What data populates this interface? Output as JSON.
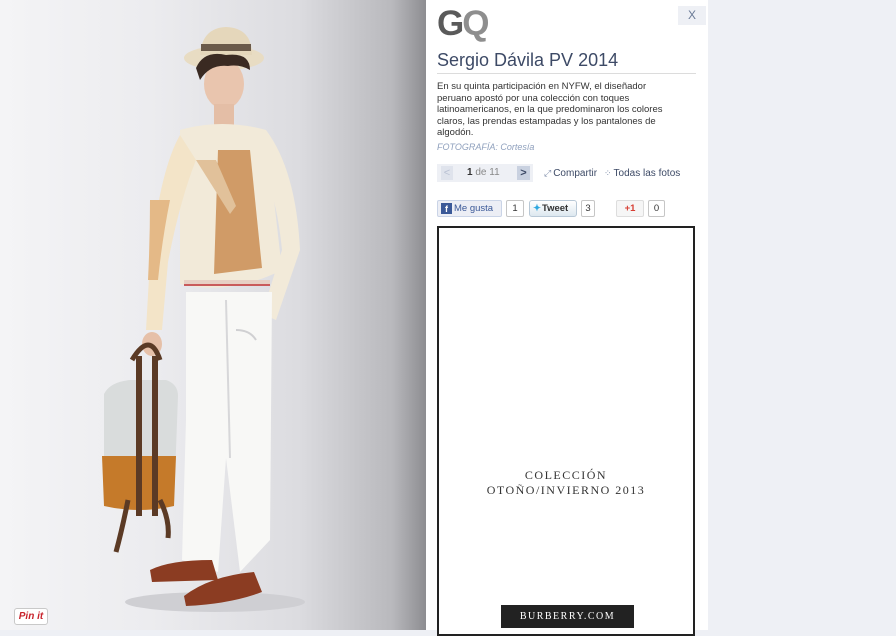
{
  "photo": {
    "pin_label": "Pin it"
  },
  "panel": {
    "logo": {
      "g": "G",
      "q": "Q"
    },
    "close_label": "X",
    "title": "Sergio Dávila PV 2014",
    "description": "En su quinta participación en NYFW, el diseñador peruano apostó por una colección con toques latinoamericanos, en la que predominaron los colores claros, las prendas estampadas y los pantalones de algodón.",
    "credit_label": "FOTOGRAFÍA:",
    "credit_name": "Cortesía",
    "pager": {
      "prev": "<",
      "current": "1",
      "of_label": "de",
      "total": "11",
      "next": ">"
    },
    "share_label": "Compartir",
    "all_photos_label": "Todas las fotos",
    "social": {
      "facebook_label": "Me gusta",
      "facebook_count": "1",
      "twitter_label": "Tweet",
      "twitter_count": "3",
      "gplus_label": "+1",
      "gplus_count": "0"
    },
    "ad": {
      "line1": "COLECCIÓN",
      "line2": "OTOÑO/INVIERNO 2013",
      "brand": "BURBERRY.COM"
    }
  },
  "colors": {
    "link_blue": "#3d4a66",
    "facebook": "#3b5998",
    "twitter": "#2fa8e0",
    "gplus": "#d73d32",
    "pinterest": "#c8232c"
  }
}
